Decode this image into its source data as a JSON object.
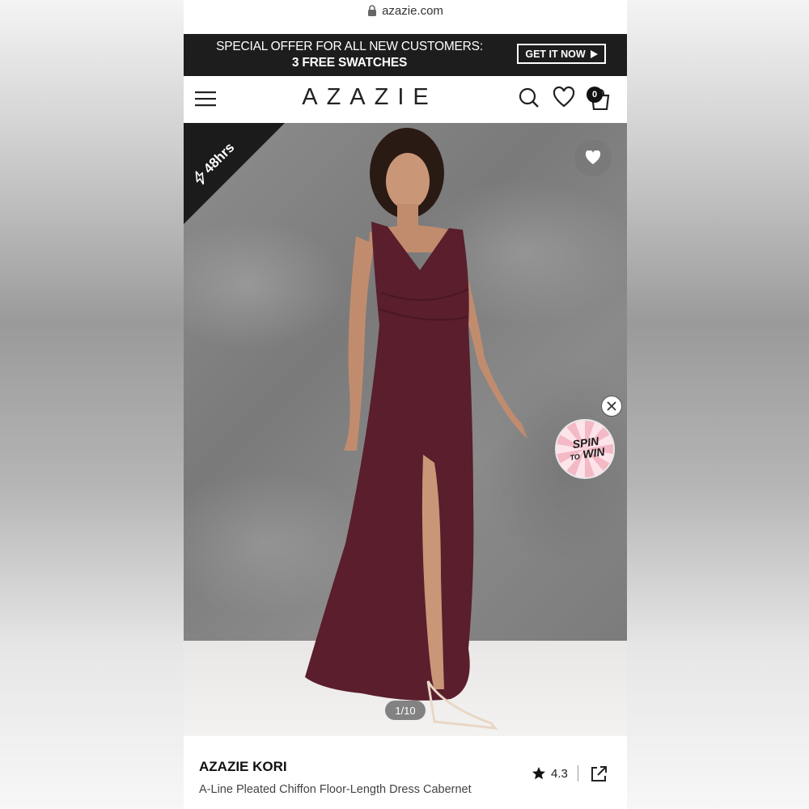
{
  "browser": {
    "url": "azazie.com"
  },
  "promo": {
    "line1": "SPECIAL OFFER FOR ALL NEW CUSTOMERS:",
    "line2": "3 FREE SWATCHES",
    "cta": "GET IT NOW"
  },
  "header": {
    "logo": "AZAZIE",
    "cart_count": "0"
  },
  "hero": {
    "badge": "48hrs",
    "spin_label_1": "SPIN",
    "spin_label_2": "TO",
    "spin_label_3": "WIN",
    "image_counter": "1/10",
    "dress_color": "#5a1e2c"
  },
  "product": {
    "name": "AZAZIE KORI",
    "description": "A-Line Pleated Chiffon Floor-Length Dress Cabernet",
    "rating": "4.3"
  }
}
